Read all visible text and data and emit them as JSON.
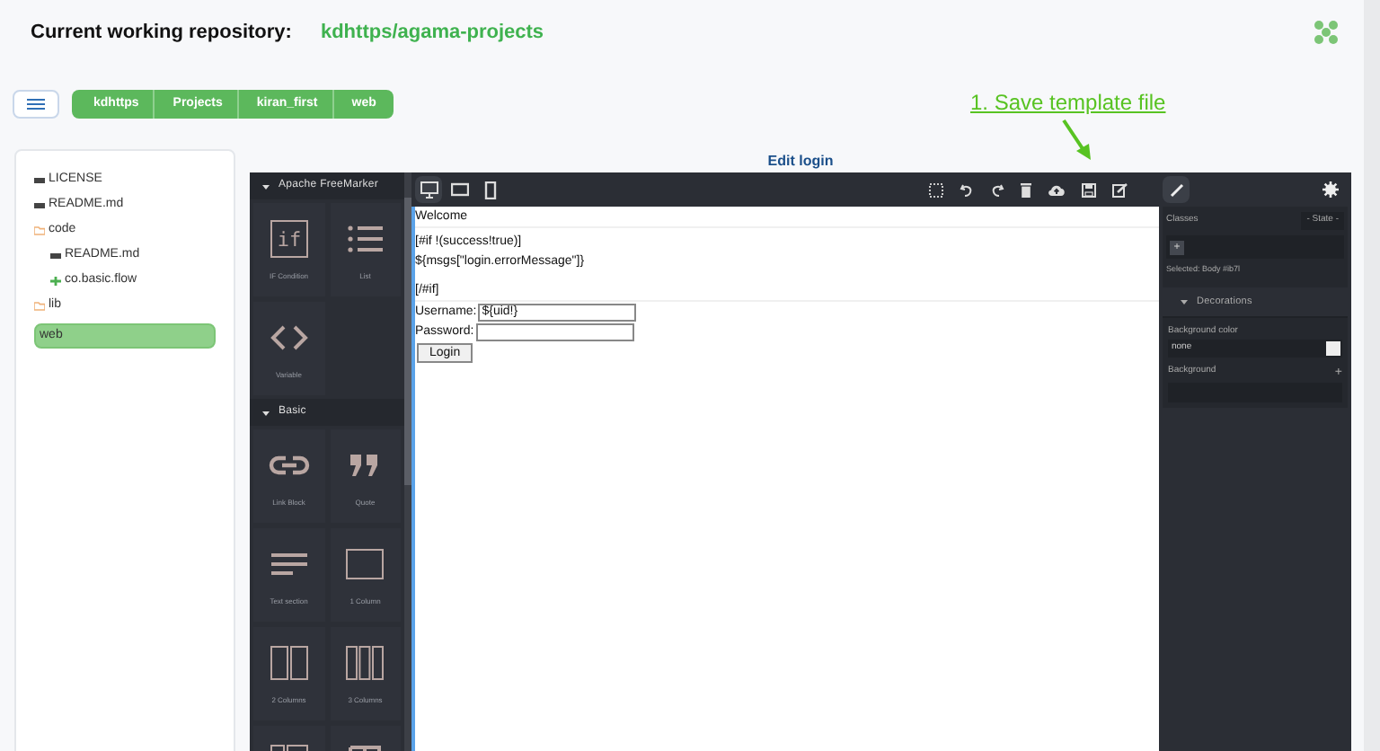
{
  "header": {
    "label": "Current working repository:",
    "repository": "kdhttps/agama-projects"
  },
  "breadcrumb": [
    {
      "label": "kdhttps"
    },
    {
      "label": "Projects"
    },
    {
      "label": "kiran_first"
    },
    {
      "label": "web"
    }
  ],
  "file_tree": [
    {
      "name": "LICENSE",
      "kind": "file",
      "selected": false
    },
    {
      "name": "README.md",
      "kind": "file",
      "selected": false
    },
    {
      "name": "code",
      "kind": "folder",
      "selected": false,
      "children": [
        {
          "name": "README.md",
          "kind": "file",
          "selected": false
        },
        {
          "name": "co.basic.flow",
          "kind": "flow",
          "selected": false
        }
      ]
    },
    {
      "name": "lib",
      "kind": "folder",
      "selected": false
    },
    {
      "name": "web",
      "kind": "folder",
      "selected": true
    }
  ],
  "annotation": "1. Save template file",
  "editor": {
    "title": "Edit login",
    "block_categories": [
      {
        "title": "Apache FreeMarker",
        "expanded": true,
        "blocks": [
          {
            "kind": "if",
            "label": "IF Condition"
          },
          {
            "kind": "list",
            "label": "List"
          },
          {
            "kind": "code",
            "label": "Variable"
          }
        ]
      },
      {
        "title": "Basic",
        "expanded": true,
        "blocks": [
          {
            "kind": "link",
            "label": "Link Block"
          },
          {
            "kind": "quote",
            "label": "Quote"
          },
          {
            "kind": "text",
            "label": "Text section"
          },
          {
            "kind": "col1",
            "label": "1 Column"
          },
          {
            "kind": "col2",
            "label": "2 Columns"
          },
          {
            "kind": "col3",
            "label": "3 Columns"
          },
          {
            "kind": "col37"
          },
          {
            "kind": "heading"
          }
        ]
      }
    ],
    "devices": [
      {
        "kind": "desktop",
        "selected": true
      },
      {
        "kind": "tablet",
        "selected": false
      },
      {
        "kind": "mobile",
        "selected": false
      }
    ],
    "canvas": {
      "lines": [
        {
          "text": "Welcome"
        },
        {
          "text": "[#if !(success!true)]"
        },
        {
          "text": "${msgs[\"login.errorMessage\"]}"
        },
        {
          "text": "[/#if]"
        }
      ],
      "username_label": "Username:",
      "username_value": "${uid!}",
      "password_label": "Password:",
      "button": "Login"
    },
    "style_manager": {
      "classes_label": "Classes",
      "state": "- State -",
      "add": "+",
      "selected_label": "Selected:",
      "selected_value": "Body",
      "selected_id": "#ib7l",
      "section": "Decorations",
      "section_expanded": true,
      "bg_color_label": "Background color",
      "bg_color_value": "none",
      "background_label": "Background",
      "background_add": "+"
    }
  }
}
